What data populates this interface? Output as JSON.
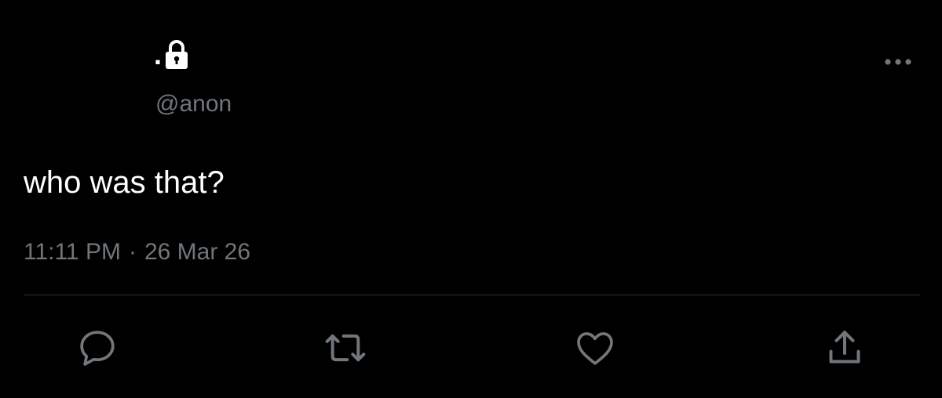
{
  "author": {
    "display_name": ".",
    "handle": "@anon",
    "lock_icon": "lock-icon"
  },
  "tweet": {
    "text": "who was that?",
    "time": "11:11 PM",
    "separator": "·",
    "date": "26 Mar 26"
  },
  "menu": {
    "icon": "more-dots-icon"
  },
  "actions": [
    {
      "name": "reply",
      "icon": "reply-icon"
    },
    {
      "name": "retweet",
      "icon": "retweet-icon"
    },
    {
      "name": "like",
      "icon": "heart-icon"
    },
    {
      "name": "share",
      "icon": "share-icon"
    }
  ],
  "colors": {
    "background": "#000000",
    "primary_text": "#ffffff",
    "secondary_text": "#71767b",
    "divider": "#2f3336"
  }
}
